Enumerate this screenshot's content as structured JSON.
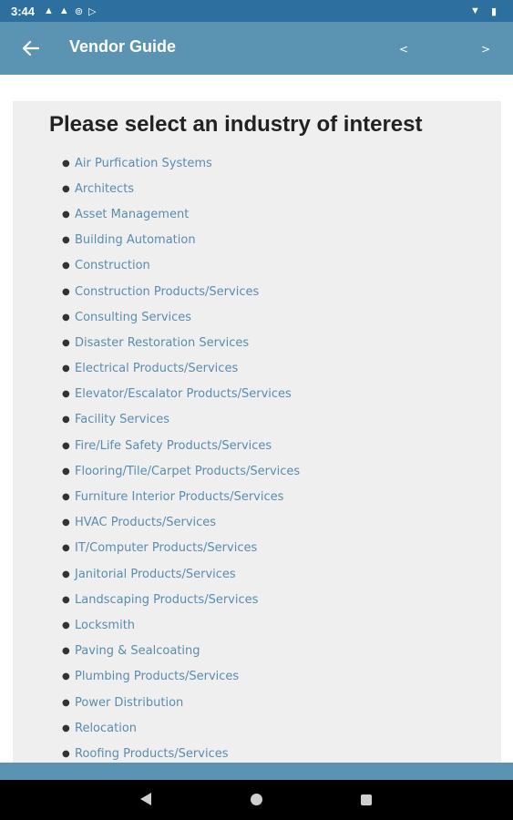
{
  "status_bar": {
    "time": "3:44",
    "left_icons": [
      "warning-icon",
      "warning-icon",
      "sync-icon",
      "play-store-icon"
    ],
    "right_icons": [
      "wifi-icon",
      "battery-icon"
    ]
  },
  "app_bar": {
    "title": "Vendor Guide",
    "back_icon": "arrow-left-icon",
    "prev_label": "<",
    "next_label": ">"
  },
  "main": {
    "heading": "Please select an industry of interest",
    "industries": [
      "Air Purfication Systems",
      "Architects",
      "Asset Management",
      "Building Automation",
      "Construction",
      "Construction Products/Services",
      "Consulting Services",
      "Disaster Restoration Services",
      "Electrical Products/Services",
      "Elevator/Escalator Products/Services",
      "Facility Services",
      "Fire/Life Safety Products/Services",
      "Flooring/Tile/Carpet Products/Services",
      "Furniture Interior Products/Services",
      "HVAC Products/Services",
      "IT/Computer Products/Services",
      "Janitorial Products/Services",
      "Landscaping Products/Services",
      "Locksmith",
      "Paving & Sealcoating",
      "Plumbing Products/Services",
      "Power Distribution",
      "Relocation",
      "Roofing Products/Services"
    ]
  },
  "colors": {
    "status_bar": "#2d6f9f",
    "app_bar": "#5b93b3",
    "link": "#5a8dad",
    "card": "#efefef"
  }
}
